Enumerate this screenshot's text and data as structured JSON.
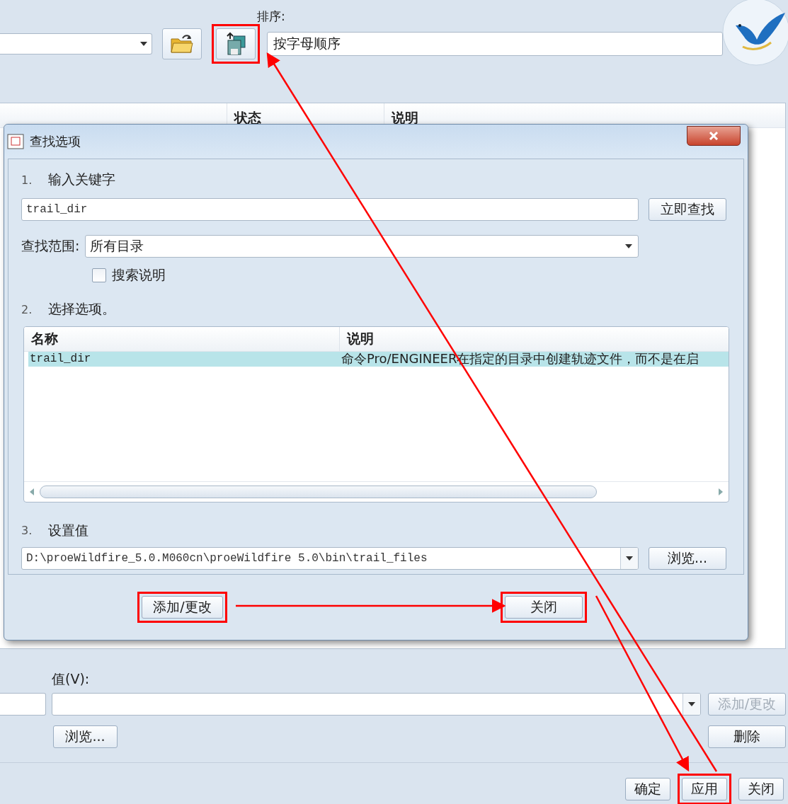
{
  "toolbar": {
    "open_button": {
      "highlighted": false
    },
    "save_button": {
      "highlighted": true
    },
    "sort": {
      "label": "排序:",
      "value": "按字母顺序"
    }
  },
  "option_list": {
    "columns": [
      "状态",
      "说明"
    ]
  },
  "dialog": {
    "title": "查找选项",
    "keyword": {
      "number": "1.",
      "label": "输入关键字",
      "value": "trail_dir",
      "button": {
        "label": "立即查找",
        "highlighted": false
      }
    },
    "scope": {
      "label": "查找范围:",
      "value": "所有目录"
    },
    "search_description": {
      "label": "搜索说明",
      "checked": false
    },
    "options": {
      "number": "2.",
      "label": "选择选项。",
      "columns": [
        "名称",
        "说明"
      ],
      "rows": [
        {
          "name": "trail_dir",
          "description": "命令Pro/ENGINEER在指定的目录中创建轨迹文件，而不是在启",
          "selected": true
        }
      ]
    },
    "setting": {
      "number": "3.",
      "label": "设置值",
      "value": "D:\\proeWildfire_5.0.M060cn\\proeWildfire 5.0\\bin\\trail_files",
      "browse": {
        "label": "浏览...",
        "highlighted": false
      }
    },
    "footer_buttons": [
      {
        "label": "添加/更改",
        "highlighted": true
      },
      {
        "label": "关闭",
        "highlighted": true
      }
    ]
  },
  "value_editor": {
    "label": "值(V):",
    "add_button": {
      "label": "添加/更改",
      "disabled": true
    },
    "browse_button": {
      "label": "浏览...",
      "disabled": false
    },
    "delete_button": {
      "label": "删除",
      "disabled": false
    }
  },
  "bottom_buttons": [
    {
      "label": "确定",
      "highlighted": false
    },
    {
      "label": "应用",
      "highlighted": true
    },
    {
      "label": "关闭",
      "highlighted": false
    }
  ]
}
